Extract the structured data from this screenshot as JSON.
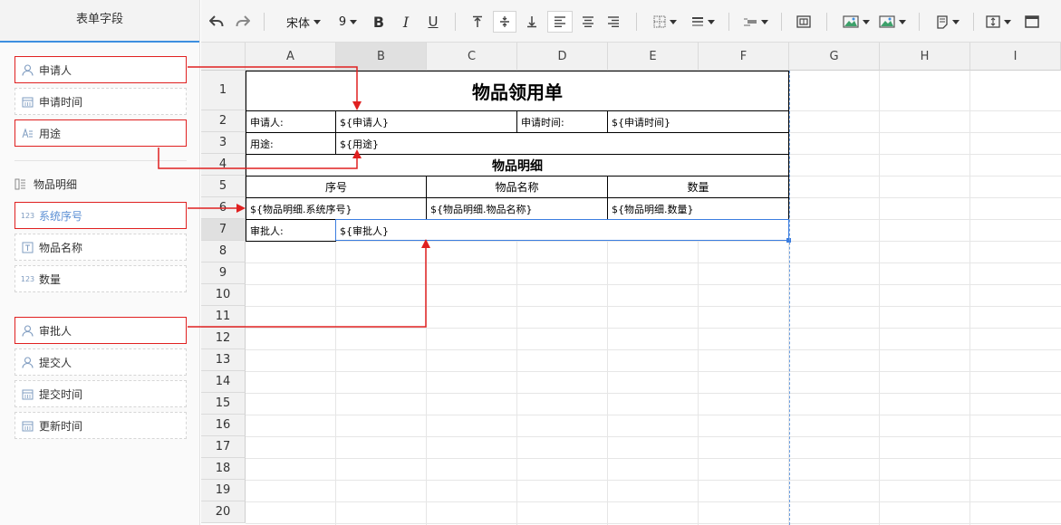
{
  "sidebar": {
    "title": "表单字段",
    "fields": [
      {
        "label": "申请人",
        "icon": "user-icon"
      },
      {
        "label": "申请时间",
        "icon": "calendar-icon"
      },
      {
        "label": "用途",
        "icon": "text-icon"
      }
    ],
    "group": {
      "label": "物品明细",
      "icon": "subtable-icon"
    },
    "group_fields": [
      {
        "label": "系统序号",
        "icon": "number-icon",
        "icon_text": "123"
      },
      {
        "label": "物品名称",
        "icon": "textbox-icon"
      },
      {
        "label": "数量",
        "icon": "number-icon",
        "icon_text": "123"
      }
    ],
    "system_fields": [
      {
        "label": "审批人",
        "icon": "user-icon"
      },
      {
        "label": "提交人",
        "icon": "user-icon"
      },
      {
        "label": "提交时间",
        "icon": "calendar-icon"
      },
      {
        "label": "更新时间",
        "icon": "calendar-icon"
      }
    ]
  },
  "toolbar": {
    "font_name": "宋体",
    "font_size": "9",
    "bold": "B",
    "italic": "I",
    "underline": "U"
  },
  "sheet": {
    "columns": [
      "A",
      "B",
      "C",
      "D",
      "E",
      "F",
      "G",
      "H",
      "I"
    ],
    "rows": [
      "1",
      "2",
      "3",
      "4",
      "5",
      "6",
      "7",
      "8",
      "9",
      "10",
      "11",
      "12",
      "13",
      "14",
      "15",
      "16",
      "17",
      "18",
      "19",
      "20"
    ],
    "selected_column": "B",
    "selected_row": "7",
    "title": "物品领用单",
    "applicant_label": "申请人:",
    "applicant_value": "${申请人}",
    "apply_time_label": "申请时间:",
    "apply_time_value": "${申请时间}",
    "purpose_label": "用途:",
    "purpose_value": "${用途}",
    "detail_title": "物品明细",
    "detail_headers": [
      "序号",
      "物品名称",
      "数量"
    ],
    "detail_values": [
      "${物品明细.系统序号}",
      "${物品明细.物品名称}",
      "${物品明细.数量}"
    ],
    "approver_label": "审批人:",
    "approver_value": "${审批人}"
  },
  "colors": {
    "highlight": "#e02020",
    "accent": "#3b7de0"
  }
}
